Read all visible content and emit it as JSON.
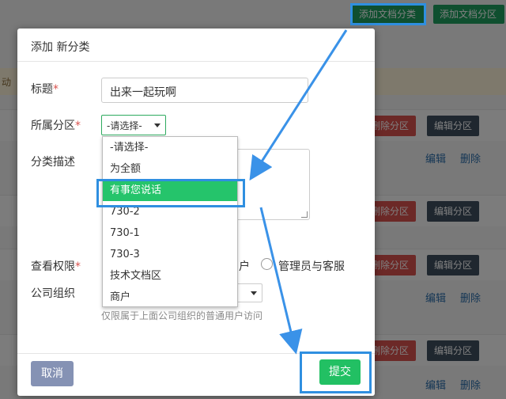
{
  "background": {
    "add_doc_category_button": "添加文档分类",
    "add_doc_section_button": "添加文档分区",
    "notice_fragment": "动",
    "delete_section_label": "删除分区",
    "edit_section_label": "编辑分区",
    "edit_link": "编辑",
    "delete_link": "删除"
  },
  "modal": {
    "title": "添加 新分类",
    "form": {
      "title_label": "标题",
      "title_value": "出来一起玩啊",
      "section_label": "所属分区",
      "section_selected": "-请选择-",
      "description_label": "分类描述",
      "permission_label": "查看权限",
      "permission_option_user_fragment": "户",
      "permission_option_admin": "管理员与客服",
      "org_label": "公司组织",
      "org_hint": "仅限属于上面公司组织的普通用户访问",
      "required_mark": "*"
    },
    "dropdown_options": [
      "-请选择-",
      "为全额",
      "有事您说话",
      "730-2",
      "730-1",
      "730-3",
      "技术文档区",
      "商户"
    ],
    "dropdown_selected": "有事您说话",
    "cancel_button": "取消",
    "submit_button": "提交"
  },
  "colors": {
    "primary_green": "#22c063",
    "highlight_blue": "#2f8fe0",
    "cancel_gray_blue": "#8592b4",
    "required_red": "#d9534f"
  }
}
